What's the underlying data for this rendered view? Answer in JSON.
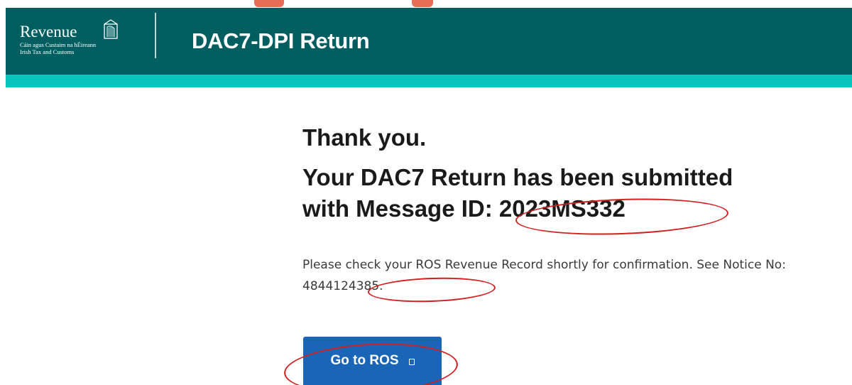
{
  "header": {
    "logo_word": "Revenue",
    "logo_sub_line1": "Cáin agus Custaim na hÉireann",
    "logo_sub_line2": "Irish Tax and Customs",
    "app_title": "DAC7-DPI Return"
  },
  "confirmation": {
    "thanks": "Thank you.",
    "submitted_text": "Your DAC7 Return has been submitted",
    "message_id_prefix": "with Message ID",
    "message_id": ": 2023MS332",
    "notice_text": "Please check your ROS Revenue Record shortly for confirmation. See Notice No",
    "notice_number": ": 4844124385."
  },
  "actions": {
    "go_to_ros_label": "Go to ROS"
  },
  "colors": {
    "header_bg": "#005e61",
    "accent_bar": "#07c5bd",
    "button_bg": "#1a65b6",
    "annotation": "#d11f1f"
  }
}
